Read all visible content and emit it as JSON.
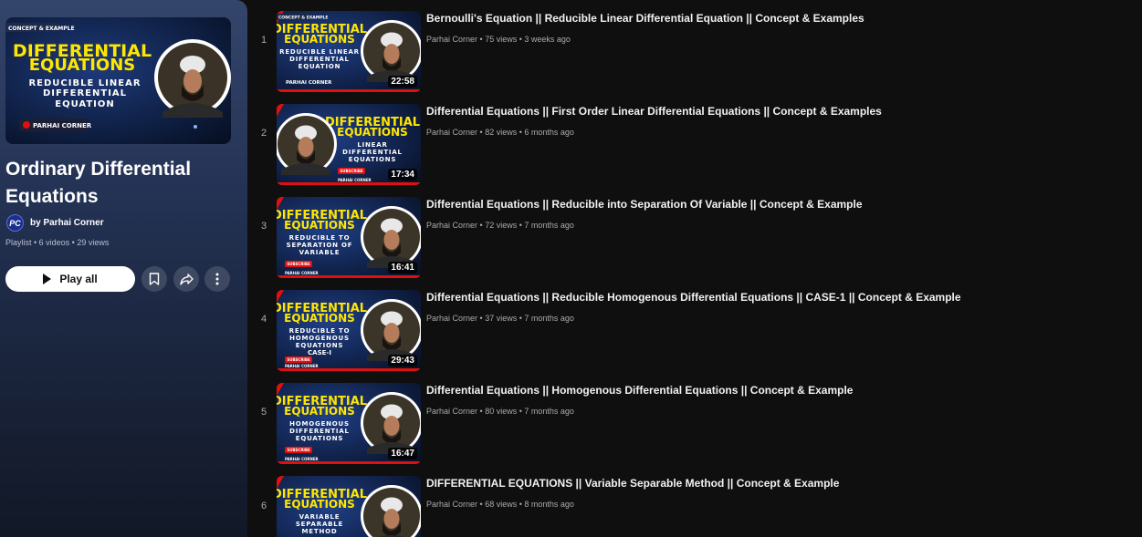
{
  "playlist": {
    "hero": {
      "tag": "CONCEPT & EXAMPLE",
      "line1": "DIFFERENTIAL",
      "line2": "EQUATIONS",
      "sub1": "REDUCIBLE LINEAR",
      "sub2": "DIFFERENTIAL",
      "sub3": "EQUATION",
      "brand": "PARHAI CORNER"
    },
    "title": "Ordinary Differential Equations",
    "owner_initials": "PC",
    "owner": "by Parhai Corner",
    "meta": "Playlist • 6 videos • 29 views",
    "play_all_label": "Play all"
  },
  "videos": [
    {
      "index": "1",
      "title": "Bernoulli's Equation || Reducible Linear Differential Equation || Concept & Examples",
      "channel": "Parhai Corner",
      "stats": "75 views • 3 weeks ago",
      "duration": "22:58",
      "thumb": {
        "l1": "DIFFERENTIAL",
        "l2": "EQUATIONS",
        "s1": "REDUCIBLE LINEAR",
        "s2": "DIFFERENTIAL",
        "s3": "EQUATION",
        "tag": "CONCEPT & EXAMPLE",
        "brand": "PARHAI CORNER"
      }
    },
    {
      "index": "2",
      "title": "Differential Equations || First Order Linear Differential Equations || Concept & Examples",
      "channel": "Parhai Corner",
      "stats": "82 views • 6 months ago",
      "duration": "17:34",
      "thumb": {
        "l1": "DIFFERENTIAL",
        "l2": "EQUATIONS",
        "s1": "LINEAR",
        "s2": "DIFFERENTIAL",
        "s3": "EQUATIONS",
        "sub": "SUBSCRIBE",
        "brand": "PARHAI CORNER"
      }
    },
    {
      "index": "3",
      "title": "Differential Equations || Reducible into Separation Of Variable || Concept & Example",
      "channel": "Parhai Corner",
      "stats": "72 views • 7 months ago",
      "duration": "16:41",
      "thumb": {
        "l1": "DIFFERENTIAL",
        "l2": "EQUATIONS",
        "s1": "REDUCIBLE TO",
        "s2": "SEPARATION OF",
        "s3": "VARIABLE",
        "sub": "SUBSCRIBE",
        "brand": "PARHAI CORNER"
      }
    },
    {
      "index": "4",
      "title": "Differential Equations || Reducible Homogenous Differential Equations || CASE-1 || Concept & Example",
      "channel": "Parhai Corner",
      "stats": "37 views • 7 months ago",
      "duration": "29:43",
      "thumb": {
        "l1": "DIFFERENTIAL",
        "l2": "EQUATIONS",
        "s1": "REDUCIBLE TO",
        "s2": "HOMOGENOUS",
        "s3": "EQUATIONS",
        "s4": "CASE-I",
        "sub": "SUBSCRIBE",
        "brand": "PARHAI CORNER"
      }
    },
    {
      "index": "5",
      "title": "Differential Equations || Homogenous Differential Equations || Concept & Example",
      "channel": "Parhai Corner",
      "stats": "80 views • 7 months ago",
      "duration": "16:47",
      "thumb": {
        "l1": "DIFFERENTIAL",
        "l2": "EQUATIONS",
        "s1": "HOMOGENOUS",
        "s2": "DIFFERENTIAL",
        "s3": "EQUATIONS",
        "sub": "SUBSCRIBE",
        "brand": "PARHAI CORNER"
      }
    },
    {
      "index": "6",
      "title": "DIFFERENTIAL EQUATIONS || Variable Separable Method || Concept & Example",
      "channel": "Parhai Corner",
      "stats": "68 views • 8 months ago",
      "duration": "",
      "thumb": {
        "l1": "DIFFERENTIAL",
        "l2": "EQUATIONS",
        "s1": "VARIABLE",
        "s2": "SEPARABLE",
        "s3": "METHOD"
      }
    }
  ],
  "colors": {
    "title_yellow": "#ffe600",
    "subscribe_red": "#e01010",
    "navy": "#0b1a3a"
  },
  "icons": {
    "play": "play-icon",
    "save": "save-playlist-icon",
    "share": "share-icon",
    "more": "more-options-icon"
  }
}
